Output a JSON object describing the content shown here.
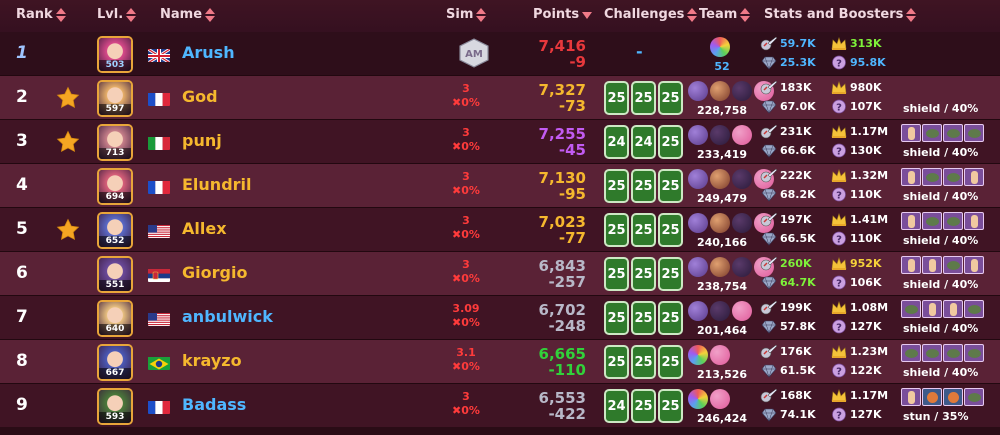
{
  "header": {
    "rank": "Rank",
    "lvl": "Lvl.",
    "name": "Name",
    "sim": "Sim",
    "points": "Points",
    "challenges": "Challenges",
    "team": "Team",
    "stats": "Stats and Boosters"
  },
  "rows": [
    {
      "rank": "1",
      "lvl": "503",
      "flag": "uk",
      "name": "Arush",
      "sim_l1": "",
      "sim_l2": "",
      "points": "7,416",
      "diff": "-9",
      "points_color": "red",
      "challenges": [],
      "team_power": "52",
      "stats": [
        "59.7K",
        "313K",
        "25.3K",
        "95.8K"
      ],
      "skill": ""
    },
    {
      "rank": "2",
      "lvl": "597",
      "flag": "fr",
      "name": "God",
      "sim_l1": "3",
      "sim_l2": "0%",
      "points": "7,327",
      "diff": "-73",
      "points_color": "gold",
      "challenges": [
        "25",
        "25",
        "25"
      ],
      "team_power": "228,758",
      "stats": [
        "183K",
        "980K",
        "67.0K",
        "107K"
      ],
      "skill": "shield / 40%"
    },
    {
      "rank": "3",
      "lvl": "713",
      "flag": "it",
      "name": "punj",
      "sim_l1": "3",
      "sim_l2": "0%",
      "points": "7,255",
      "diff": "-45",
      "points_color": "purple",
      "challenges": [
        "24",
        "24",
        "25"
      ],
      "team_power": "233,419",
      "stats": [
        "231K",
        "1.17M",
        "66.6K",
        "130K"
      ],
      "skill": "shield / 40%"
    },
    {
      "rank": "4",
      "lvl": "694",
      "flag": "fr",
      "name": "Elundril",
      "sim_l1": "3",
      "sim_l2": "0%",
      "points": "7,130",
      "diff": "-95",
      "points_color": "gold",
      "challenges": [
        "25",
        "25",
        "25"
      ],
      "team_power": "249,479",
      "stats": [
        "222K",
        "1.32M",
        "68.2K",
        "110K"
      ],
      "skill": "shield / 40%"
    },
    {
      "rank": "5",
      "lvl": "652",
      "flag": "us",
      "name": "Allex",
      "sim_l1": "3",
      "sim_l2": "0%",
      "points": "7,023",
      "diff": "-77",
      "points_color": "gold",
      "challenges": [
        "25",
        "25",
        "25"
      ],
      "team_power": "240,166",
      "stats": [
        "197K",
        "1.41M",
        "66.5K",
        "110K"
      ],
      "skill": "shield / 40%"
    },
    {
      "rank": "6",
      "lvl": "551",
      "flag": "rs",
      "name": "Giorgio",
      "sim_l1": "3",
      "sim_l2": "0%",
      "points": "6,843",
      "diff": "-257",
      "points_color": "grey",
      "challenges": [
        "25",
        "25",
        "25"
      ],
      "team_power": "238,754",
      "stats": [
        "260K",
        "952K",
        "64.7K",
        "106K"
      ],
      "skill": "shield / 40%"
    },
    {
      "rank": "7",
      "lvl": "640",
      "flag": "us",
      "name": "anbulwick",
      "sim_l1": "3.09",
      "sim_l2": "0%",
      "points": "6,702",
      "diff": "-248",
      "points_color": "grey",
      "challenges": [
        "25",
        "25",
        "25"
      ],
      "team_power": "201,464",
      "stats": [
        "199K",
        "1.08M",
        "57.8K",
        "127K"
      ],
      "skill": "shield / 40%"
    },
    {
      "rank": "8",
      "lvl": "667",
      "flag": "br",
      "name": "krayzo",
      "sim_l1": "3.1",
      "sim_l2": "0%",
      "points": "6,665",
      "diff": "-110",
      "points_color": "green",
      "challenges": [
        "25",
        "25",
        "25"
      ],
      "team_power": "213,526",
      "stats": [
        "176K",
        "1.23M",
        "61.5K",
        "122K"
      ],
      "skill": "shield / 40%"
    },
    {
      "rank": "9",
      "lvl": "593",
      "flag": "fr",
      "name": "Badass",
      "sim_l1": "3",
      "sim_l2": "0%",
      "points": "6,553",
      "diff": "-422",
      "points_color": "grey",
      "challenges": [
        "24",
        "25",
        "25"
      ],
      "team_power": "246,424",
      "stats": [
        "168K",
        "1.17M",
        "74.1K",
        "127K"
      ],
      "skill": "stun / 35%"
    }
  ]
}
